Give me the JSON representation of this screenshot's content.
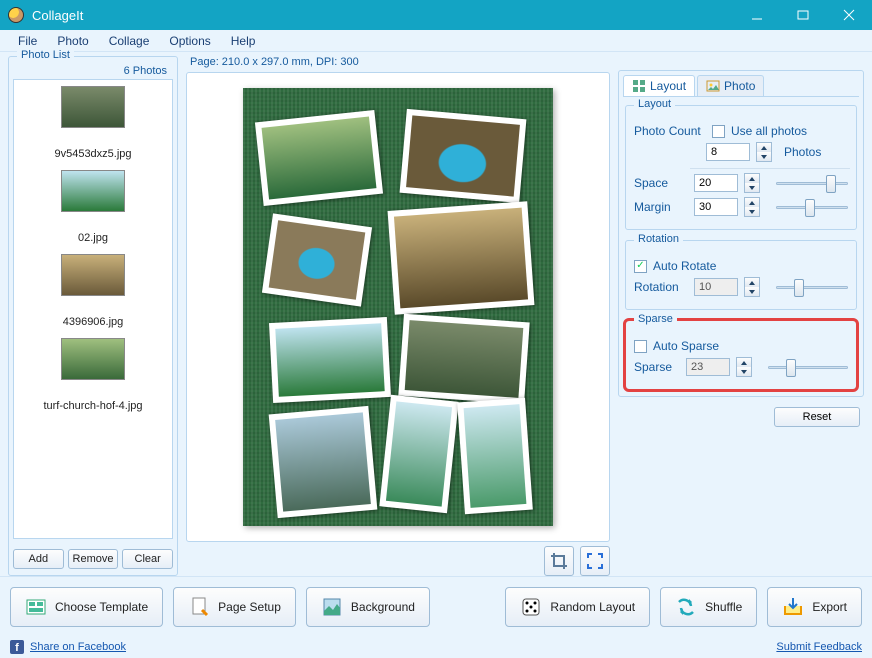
{
  "window": {
    "title": "CollageIt"
  },
  "menu": {
    "items": [
      "File",
      "Photo",
      "Collage",
      "Options",
      "Help"
    ]
  },
  "photoList": {
    "title": "Photo List",
    "count_label": "6 Photos",
    "items": [
      {
        "name": "9v5453dxz5.jpg"
      },
      {
        "name": "02.jpg"
      },
      {
        "name": "4396906.jpg"
      },
      {
        "name": "turf-church-hof-4.jpg"
      }
    ],
    "buttons": {
      "add": "Add",
      "remove": "Remove",
      "clear": "Clear"
    }
  },
  "canvas": {
    "page_info": "Page: 210.0 x 297.0 mm, DPI: 300"
  },
  "tabs": {
    "layout": "Layout",
    "photo": "Photo"
  },
  "layout": {
    "group_title": "Layout",
    "photo_count_label": "Photo Count",
    "use_all_label": "Use all photos",
    "use_all_checked": false,
    "photo_count_value": "8",
    "photos_suffix": "Photos",
    "space_label": "Space",
    "space_value": "20",
    "margin_label": "Margin",
    "margin_value": "30"
  },
  "rotation": {
    "group_title": "Rotation",
    "auto_label": "Auto Rotate",
    "auto_checked": true,
    "rotation_label": "Rotation",
    "rotation_value": "10"
  },
  "sparse": {
    "group_title": "Sparse",
    "auto_label": "Auto Sparse",
    "auto_checked": false,
    "sparse_label": "Sparse",
    "sparse_value": "23"
  },
  "reset_label": "Reset",
  "bottomButtons": {
    "template": "Choose Template",
    "page_setup": "Page Setup",
    "background": "Background",
    "random": "Random Layout",
    "shuffle": "Shuffle",
    "export": "Export"
  },
  "footer": {
    "share": "Share on Facebook",
    "feedback": "Submit Feedback"
  }
}
